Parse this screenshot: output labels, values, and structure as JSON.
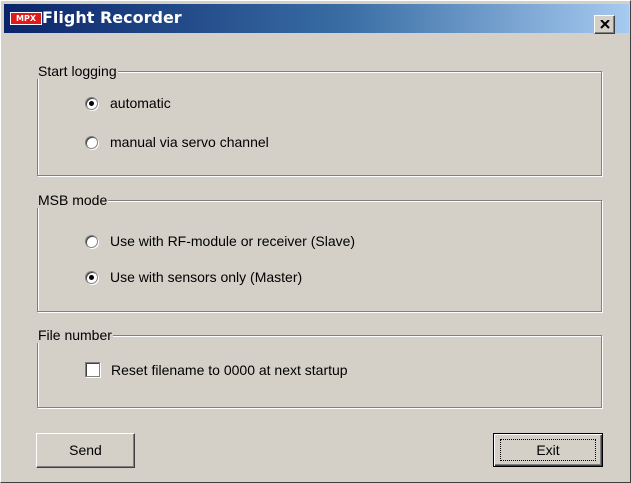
{
  "window": {
    "title": "Flight Recorder",
    "logo_text": "MPX",
    "close_label": "×"
  },
  "groups": {
    "start_logging": {
      "label": "Start logging",
      "options": [
        {
          "label": "automatic",
          "checked": true
        },
        {
          "label": "manual via servo channel",
          "checked": false
        }
      ]
    },
    "msb_mode": {
      "label": "MSB mode",
      "options": [
        {
          "label": "Use with RF-module or receiver (Slave)",
          "checked": false
        },
        {
          "label": "Use with sensors only (Master)",
          "checked": true
        }
      ]
    },
    "file_number": {
      "label": "File number",
      "checkbox_label": "Reset filename to 0000 at next startup",
      "checked": false
    }
  },
  "buttons": {
    "send": "Send",
    "exit": "Exit"
  },
  "colors": {
    "title_start": "#0a246a",
    "title_end": "#a6caf0",
    "face": "#d4d0c8",
    "logo_red": "#e01a1a"
  }
}
